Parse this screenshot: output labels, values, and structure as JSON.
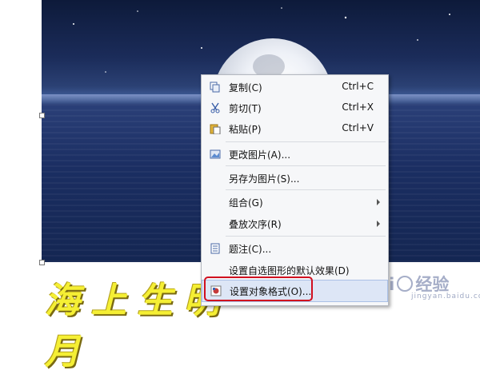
{
  "context_menu": {
    "items": [
      {
        "label": "复制(C)",
        "shortcut": "Ctrl+C",
        "icon": "copy-icon"
      },
      {
        "label": "剪切(T)",
        "shortcut": "Ctrl+X",
        "icon": "cut-icon"
      },
      {
        "label": "粘贴(P)",
        "shortcut": "Ctrl+V",
        "icon": "paste-icon"
      },
      {
        "label": "更改图片(A)...",
        "icon": "change-picture-icon"
      },
      {
        "label": "另存为图片(S)..."
      },
      {
        "label": "组合(G)",
        "submenu": true
      },
      {
        "label": "叠放次序(R)",
        "submenu": true
      },
      {
        "label": "题注(C)...",
        "icon": "caption-icon"
      },
      {
        "label": "设置自选图形的默认效果(D)"
      },
      {
        "label": "设置对象格式(O)...",
        "icon": "format-object-icon",
        "highlighted": true
      }
    ]
  },
  "wordart_text": "海上生明月",
  "watermark": {
    "text_left": "Bai",
    "text_right": "经验",
    "sub": "jingyan.baidu.com"
  },
  "colors": {
    "highlight_border": "#d10f1f",
    "wordart": "#f5ef34",
    "menu_bg": "#f6f7f9"
  }
}
